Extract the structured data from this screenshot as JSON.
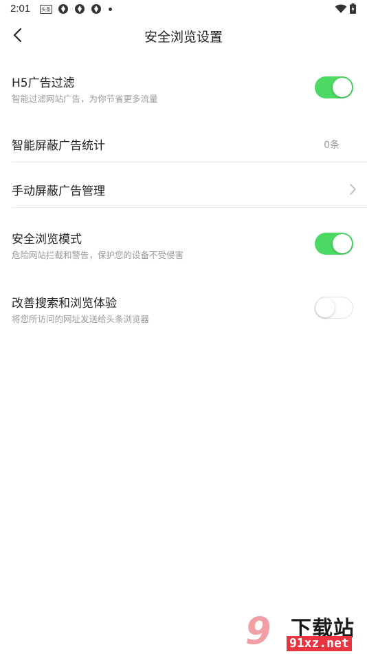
{
  "status_bar": {
    "time": "2:01",
    "news_badge": "头条",
    "icons_left": [
      "news-badge-icon",
      "aperture-icon",
      "aperture-icon",
      "aperture-icon",
      "dot-icon"
    ],
    "icons_right": [
      "wifi-icon",
      "battery-charging-icon"
    ]
  },
  "header": {
    "title": "安全浏览设置",
    "back_icon": "chevron-left-icon"
  },
  "settings": {
    "h5_filter": {
      "title": "H5广告过滤",
      "desc": "智能过滤网站广告，为你节省更多流量",
      "enabled": true
    },
    "smart_block_stats": {
      "title": "智能屏蔽广告统计",
      "value": "0条"
    },
    "manual_block": {
      "title": "手动屏蔽广告管理",
      "icon": "chevron-right-icon"
    },
    "safe_mode": {
      "title": "安全浏览模式",
      "desc": "危险网站拦截和警告，保护您的设备不受侵害",
      "enabled": true
    },
    "improve_search": {
      "title": "改善搜索和浏览体验",
      "desc": "将您所访问的网址发送给头条浏览器",
      "enabled": false
    }
  },
  "colors": {
    "toggle_on": "#4cd964",
    "toggle_off_border": "#e3e3e3",
    "secondary_text": "#999999"
  },
  "watermark": {
    "logo_glyph": "9",
    "brand": "下载站",
    "url": "91xz.net"
  }
}
